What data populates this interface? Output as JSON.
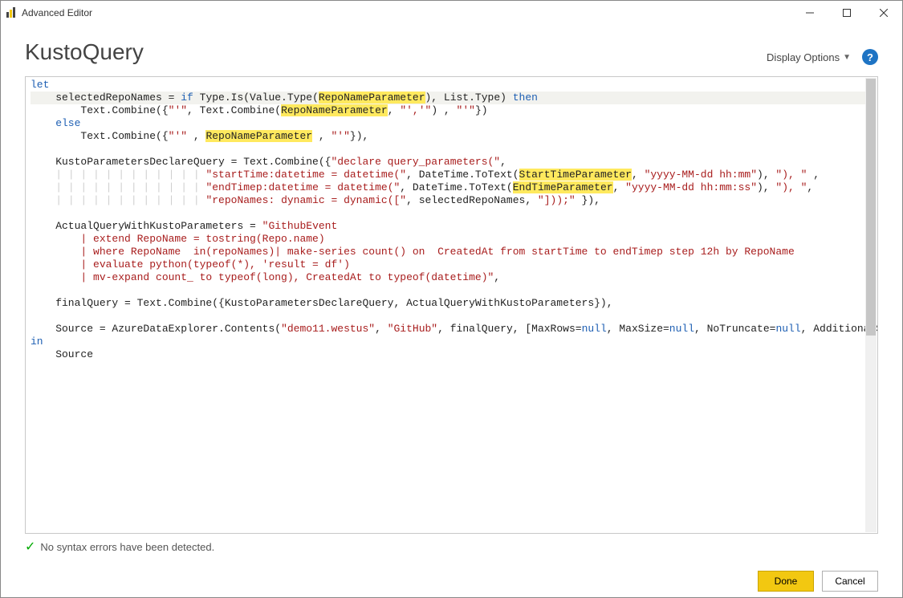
{
  "title": "Advanced Editor",
  "queryName": "KustoQuery",
  "displayOptionsLabel": "Display Options",
  "statusMessage": "No syntax errors have been detected.",
  "buttons": {
    "done": "Done",
    "cancel": "Cancel"
  },
  "code": {
    "l01_kw": "let",
    "l02a": "    selectedRepoNames = ",
    "l02_if": "if",
    "l02b": " Type.Is(Value.Type(",
    "l02_p1": "RepoNameParameter",
    "l02c": "), List.Type) ",
    "l02_then": "then",
    "l03a": "        Text.Combine({",
    "l03_s1": "\"'\"",
    "l03b": ", Text.Combine(",
    "l03_p1": "RepoNameParameter",
    "l03c": ", ",
    "l03_s2": "\"','\"",
    "l03d": ") , ",
    "l03_s3": "\"'\"",
    "l03e": "})",
    "l04_else": "    else",
    "l05a": "        Text.Combine({",
    "l05_s1": "\"'\"",
    "l05b": " , ",
    "l05_p1": "RepoNameParameter",
    "l05c": " , ",
    "l05_s2": "\"'\"",
    "l05d": "}),",
    "l07a": "    KustoParametersDeclareQuery = Text.Combine({",
    "l07_s1": "\"declare query_parameters(\"",
    "l07b": ",",
    "l08_s1": "\"startTime:datetime = datetime(\"",
    "l08b": ", DateTime.ToText(",
    "l08_p1": "StartTimeParameter",
    "l08c": ", ",
    "l08_s2": "\"yyyy-MM-dd hh:mm\"",
    "l08d": "), ",
    "l08_s3": "\"), \"",
    "l08e": " ,",
    "l09_s1": "\"endTimep:datetime = datetime(\"",
    "l09b": ", DateTime.ToText(",
    "l09_p1": "EndTimeParameter",
    "l09c": ", ",
    "l09_s2": "\"yyyy-MM-dd hh:mm:ss\"",
    "l09d": "), ",
    "l09_s3": "\"), \"",
    "l09e": ",",
    "l10_s1": "\"repoNames: dynamic = dynamic([\"",
    "l10b": ", selectedRepoNames, ",
    "l10_s2": "\"]));\"",
    "l10c": " }),",
    "l12a": "    ActualQueryWithKustoParameters = ",
    "l12_s1": "\"GithubEvent",
    "l13_s1": "        | extend RepoName = tostring(Repo.name)",
    "l14_s1": "        | where RepoName  in(repoNames)| make-series count() on  CreatedAt from startTime to endTimep step 12h by RepoName",
    "l15_s1": "        | evaluate python(typeof(*), 'result = df')",
    "l16_s1": "        | mv-expand count_ to typeof(long), CreatedAt to typeof(datetime)\"",
    "l16b": ",",
    "l18a": "    finalQuery = Text.Combine({KustoParametersDeclareQuery, ActualQueryWithKustoParameters}),",
    "l20a": "    Source = AzureDataExplorer.Contents(",
    "l20_s1": "\"demo11.westus\"",
    "l20b": ", ",
    "l20_s2": "\"GitHub\"",
    "l20c": ", finalQuery, [MaxRows=",
    "l20_n1": "null",
    "l20d": ", MaxSize=",
    "l20_n2": "null",
    "l20e": ", NoTruncate=",
    "l20_n3": "null",
    "l20f": ", AdditionalSetStatements=",
    "l20_n4": "null",
    "l20g": "])",
    "l21_in": "in",
    "l22a": "    Source"
  }
}
